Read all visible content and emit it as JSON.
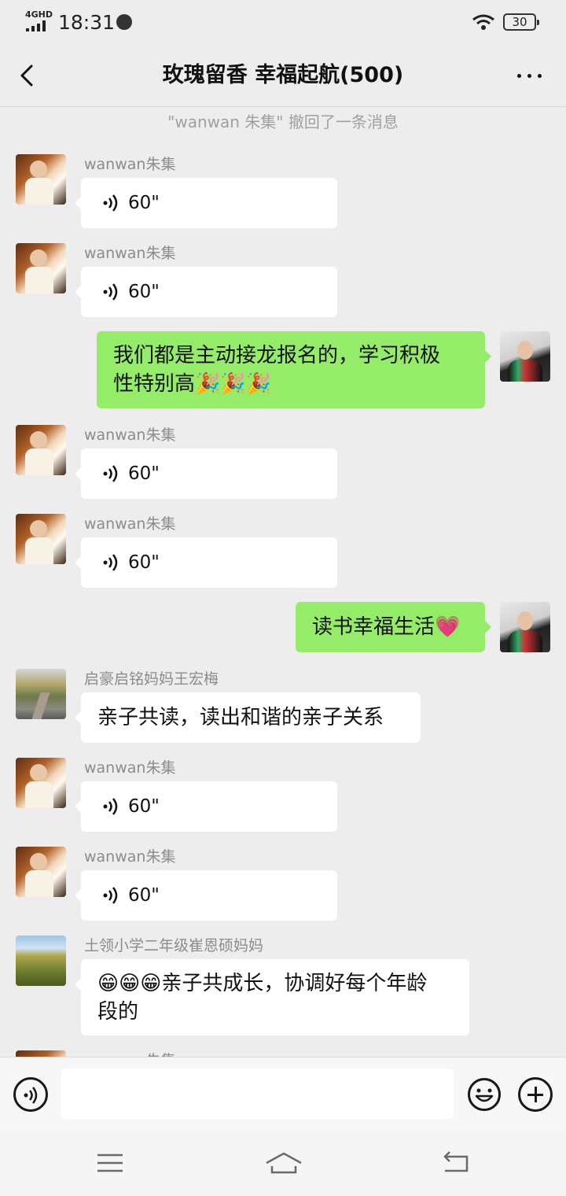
{
  "status_bar": {
    "network": "4GHD",
    "time": "18:31",
    "battery": "30"
  },
  "header": {
    "title": "玫瑰留香  幸福起航(500)",
    "back_icon": "chevron-left-icon",
    "more_icon": "more-dots-icon"
  },
  "system_message": "\"wanwan 朱集\" 撤回了一条消息",
  "messages": [
    {
      "sender": "wanwan朱集",
      "type": "voice",
      "duration": "60\""
    },
    {
      "sender": "wanwan朱集",
      "type": "voice",
      "duration": "60\""
    },
    {
      "sender": "me",
      "type": "text",
      "lines": [
        "我们都是主动接龙报名的，学习积极",
        "性特别高🎉🎉🎉"
      ]
    },
    {
      "sender": "wanwan朱集",
      "type": "voice",
      "duration": "60\""
    },
    {
      "sender": "wanwan朱集",
      "type": "voice",
      "duration": "60\""
    },
    {
      "sender": "me",
      "type": "text",
      "lines": [
        "读书幸福生活💗"
      ]
    },
    {
      "sender": "启豪启铭妈妈王宏梅",
      "type": "text",
      "lines": [
        "亲子共读，读出和谐的亲子关系"
      ]
    },
    {
      "sender": "wanwan朱集",
      "type": "voice",
      "duration": "60\""
    },
    {
      "sender": "wanwan朱集",
      "type": "voice",
      "duration": "60\""
    },
    {
      "sender": "土领小学二年级崔恩硕妈妈",
      "type": "text",
      "lines": [
        "😁😁😁亲子共成长，协调好每个年龄",
        "段的"
      ]
    },
    {
      "sender": "wanwan朱集",
      "type": "partial"
    }
  ],
  "input_bar": {
    "placeholder": "",
    "voice_icon": "voice-mode-icon",
    "emoji_icon": "emoji-icon",
    "plus_icon": "plus-icon"
  },
  "nav_bar": {
    "menu_icon": "menu-icon",
    "home_icon": "home-icon",
    "back_icon": "back-icon"
  },
  "colors": {
    "background": "#ededed",
    "outgoing_bubble": "#95ec69",
    "incoming_bubble": "#ffffff",
    "meta_text": "#8c8c8c"
  }
}
